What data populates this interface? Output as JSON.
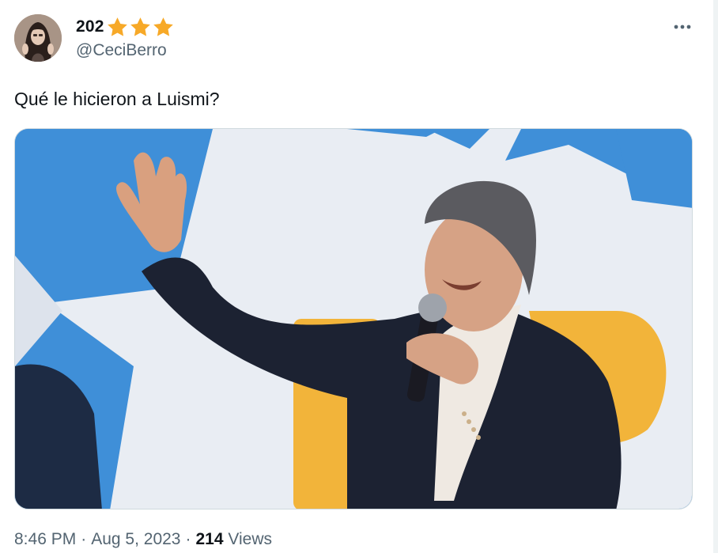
{
  "author": {
    "display_name": "202",
    "handle": "@CeciBerro",
    "badge_icons": [
      "star-icon",
      "star-icon",
      "star-icon"
    ],
    "avatar_icon": "avatar-photo"
  },
  "tweet": {
    "text": "Qué le hicieron a Luismi?",
    "media_icon": "photo-man-waving-with-microphone"
  },
  "meta": {
    "time": "8:46 PM",
    "separator": "·",
    "date": "Aug 5, 2023",
    "views_count": "214",
    "views_label": "Views"
  },
  "colors": {
    "star": "#f7a928",
    "secondary_text": "#536471",
    "primary_text": "#0f1419",
    "media_blue": "#3f8fd8",
    "media_yellow": "#f2b43a"
  }
}
